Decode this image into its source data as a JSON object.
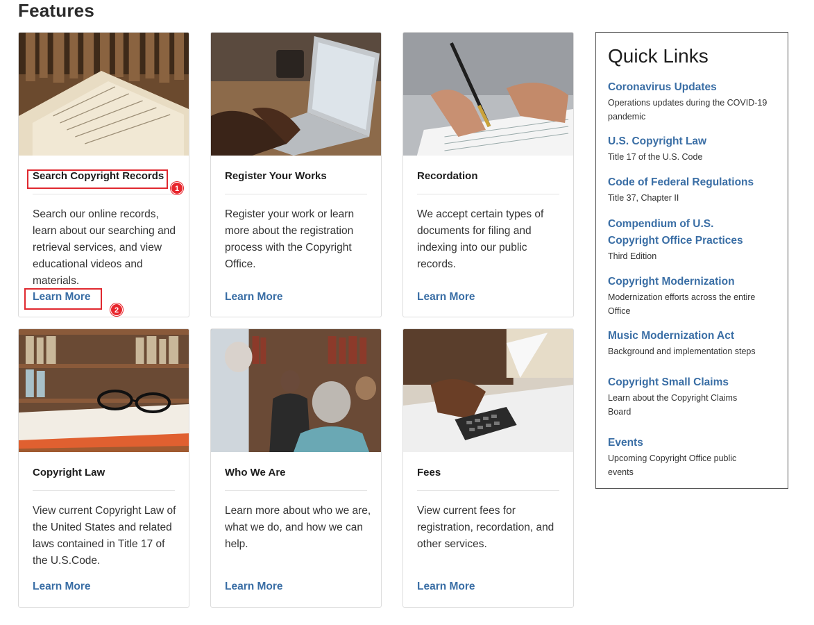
{
  "page": {
    "title": "Features"
  },
  "cards": [
    {
      "title": "Search Copyright Records",
      "text": "Search our online records, learn about our searching and retrieval services, and view educational videos and materials.",
      "link": "Learn More"
    },
    {
      "title": "Register Your Works",
      "text": "Register your work or learn more about the registration process with the Copyright Office.",
      "link": "Learn More"
    },
    {
      "title": "Recordation",
      "text": "We accept certain types of documents for filing and indexing into our public records.",
      "link": "Learn More"
    },
    {
      "title": "Copyright Law",
      "text": "View current Copyright Law of the United States and related laws contained in Title 17 of the U.S.Code.",
      "link": "Learn More"
    },
    {
      "title": "Who We Are",
      "text": "Learn more about who we are, what we do, and how we can help.",
      "link": "Learn More"
    },
    {
      "title": "Fees",
      "text": "View current fees for registration, recordation, and other services.",
      "link": "Learn More"
    }
  ],
  "quick_links": {
    "title": "Quick Links",
    "items": [
      {
        "label": "Coronavirus Updates",
        "desc": "Operations updates during the COVID-19 pandemic"
      },
      {
        "label": "U.S. Copyright Law",
        "desc": "Title 17 of the U.S. Code"
      },
      {
        "label": "Code of Federal Regulations",
        "desc": "Title 37, Chapter II"
      },
      {
        "label": "Compendium of U.S. Copyright Office Practices",
        "desc": "Third Edition"
      },
      {
        "label": "Copyright Modernization",
        "desc": "Modernization efforts across the entire Office"
      },
      {
        "label": "Music Modernization Act",
        "desc": "Background and implementation steps"
      },
      {
        "label": "Copyright Small Claims",
        "desc": "Learn about the Copyright Claims Board"
      },
      {
        "label": "Events",
        "desc": "Upcoming Copyright Office public events"
      }
    ]
  },
  "annotations": {
    "badge1": "1",
    "badge2": "2"
  },
  "colors": {
    "link": "#3a6ea5",
    "highlight": "#e0282f"
  }
}
